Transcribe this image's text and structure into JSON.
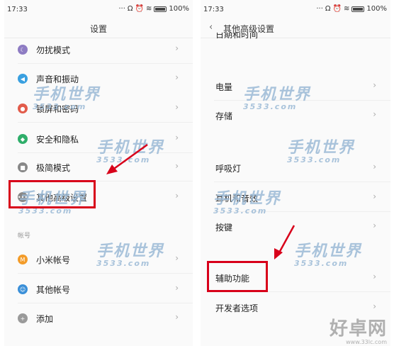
{
  "left_screen": {
    "status_time": "17:33",
    "battery": "100%",
    "title": "设置",
    "items": [
      {
        "label": "勿扰模式",
        "icon": "moon-icon",
        "color": "#8e7cc3"
      },
      {
        "label": "声音和振动",
        "icon": "speaker-icon",
        "color": "#3aa0e0"
      },
      {
        "label": "锁屏和密码",
        "icon": "lock-icon",
        "color": "#e25c4b"
      },
      {
        "label": "安全和隐私",
        "icon": "shield-icon",
        "color": "#2fae6a"
      },
      {
        "label": "极简模式",
        "icon": "minimal-icon",
        "color": "#888888"
      },
      {
        "label": "其他高级设置",
        "icon": "more-icon",
        "color": "#888888"
      }
    ],
    "section_accounts": "帐号",
    "account_items": [
      {
        "label": "小米帐号",
        "icon": "mi-icon",
        "color": "#f39c2a"
      },
      {
        "label": "其他帐号",
        "icon": "person-icon",
        "color": "#3a8fd8"
      },
      {
        "label": "添加",
        "icon": "plus-icon",
        "color": "#9a9a9a"
      }
    ]
  },
  "right_screen": {
    "status_time": "17:33",
    "battery": "100%",
    "title": "其他高级设置",
    "back_symbol": "‹",
    "partial_item": "日期和时间",
    "items": [
      {
        "label": "电量"
      },
      {
        "label": "存储"
      },
      {
        "label": "呼吸灯"
      },
      {
        "label": "耳机和音效"
      },
      {
        "label": "按键"
      },
      {
        "label": "辅助功能"
      },
      {
        "label": "开发者选项"
      }
    ]
  },
  "watermark": {
    "text": "手机世界",
    "sub": "3533.com"
  },
  "brand": {
    "name": "好卓网",
    "url": "www.33lc.com"
  },
  "colors": {
    "highlight": "#d8001a",
    "divider": "#eeeeee"
  }
}
